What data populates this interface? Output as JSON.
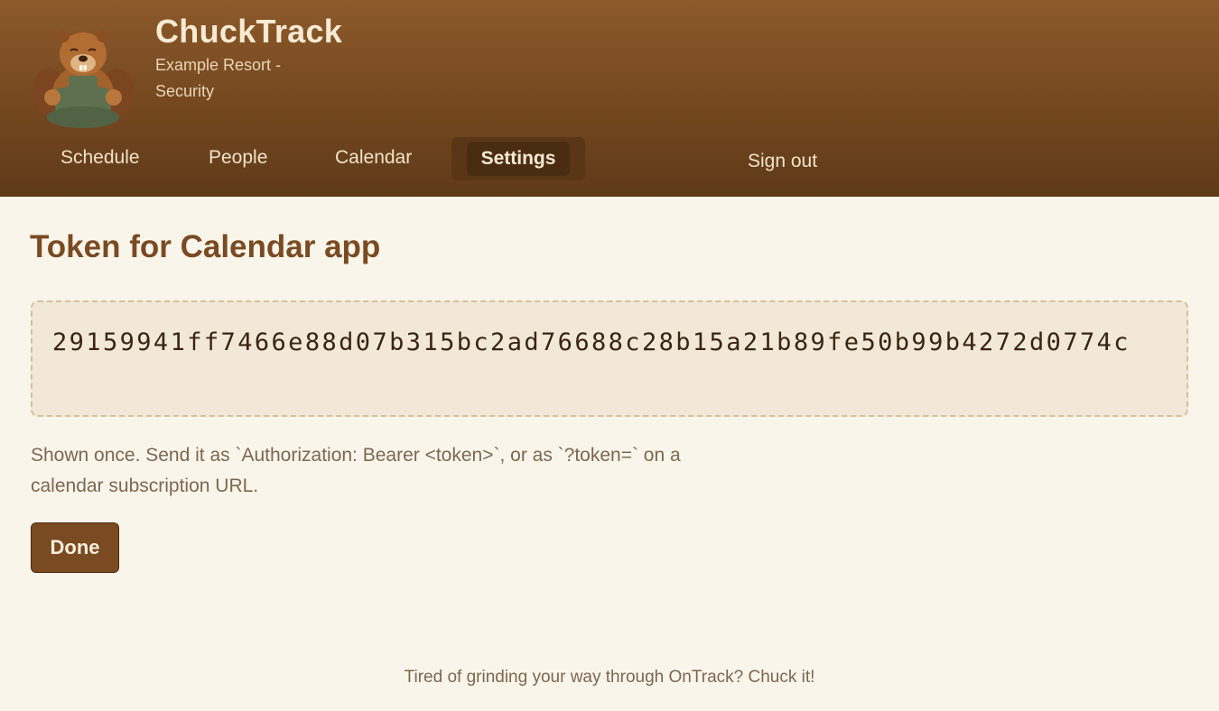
{
  "header": {
    "logo_icon": "beaver-mascot-icon",
    "brand_title": "ChuckTrack",
    "brand_subtitle": "Example Resort - Security",
    "colors": {
      "header_top": "#8c5a2b",
      "header_bottom": "#5f3a1a",
      "active_tab_bg": "#4a2c12"
    }
  },
  "nav": {
    "items": [
      {
        "label": "Schedule",
        "active": false
      },
      {
        "label": "People",
        "active": false
      },
      {
        "label": "Calendar",
        "active": false
      },
      {
        "label": "Settings",
        "active": true
      }
    ],
    "sign_out_label": "Sign out"
  },
  "main": {
    "title": "Token for Calendar app",
    "token": "29159941ff7466e88d07b315bc2ad76688c28b15a21b89fe50b99b4272d0774c",
    "hint": "Shown once. Send it as `Authorization: Bearer <token>`, or as `?token=` on a calendar subscription URL.",
    "done_label": "Done",
    "colors": {
      "accent": "#7a4a22",
      "background": "#faf5ea",
      "token_box_bg": "#f2e8d7"
    }
  },
  "footer": {
    "text": "Tired of grinding your way through OnTrack? Chuck it!"
  }
}
